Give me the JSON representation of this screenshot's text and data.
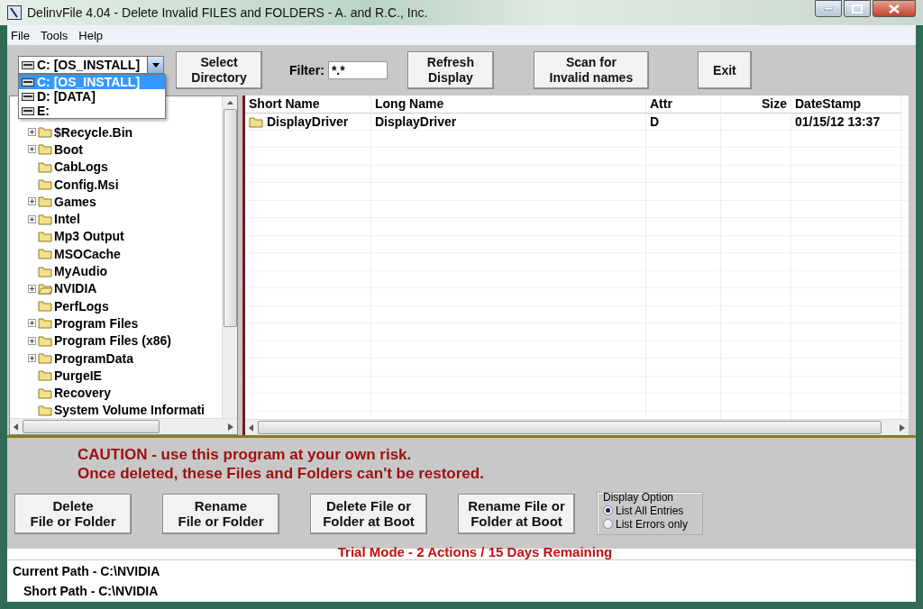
{
  "window": {
    "title": "DelinvFile 4.04 - Delete Invalid FILES and FOLDERS - A. and R.C., Inc."
  },
  "menu": [
    "File",
    "Tools",
    "Help"
  ],
  "drive_combo": {
    "value": "C: [OS_INSTALL]",
    "options": [
      {
        "label": "C: [OS_INSTALL]",
        "selected": true
      },
      {
        "label": "D: [DATA]",
        "selected": false
      },
      {
        "label": "E:",
        "selected": false
      }
    ]
  },
  "toolbar": [
    {
      "kind": "button",
      "lines": [
        "Select",
        "Directory"
      ]
    },
    {
      "kind": "filter",
      "label": "Filter:",
      "value": "*.*"
    },
    {
      "kind": "button",
      "lines": [
        "Refresh",
        "Display"
      ]
    },
    {
      "kind": "button",
      "lines": [
        "Scan for",
        "Invalid names"
      ]
    },
    {
      "kind": "button",
      "lines": [
        "Exit"
      ]
    }
  ],
  "tree": {
    "items": [
      {
        "label": "$Recycle.Bin",
        "expandable": true
      },
      {
        "label": "Boot",
        "expandable": true
      },
      {
        "label": "CabLogs",
        "expandable": false
      },
      {
        "label": "Config.Msi",
        "expandable": false
      },
      {
        "label": "Games",
        "expandable": true
      },
      {
        "label": "Intel",
        "expandable": true
      },
      {
        "label": "Mp3 Output",
        "expandable": false
      },
      {
        "label": "MSOCache",
        "expandable": false
      },
      {
        "label": "MyAudio",
        "expandable": false
      },
      {
        "label": "NVIDIA",
        "expandable": true
      },
      {
        "label": "PerfLogs",
        "expandable": false
      },
      {
        "label": "Program Files",
        "expandable": true
      },
      {
        "label": "Program Files (x86)",
        "expandable": true
      },
      {
        "label": "ProgramData",
        "expandable": true
      },
      {
        "label": "PurgeIE",
        "expandable": false
      },
      {
        "label": "Recovery",
        "expandable": false
      },
      {
        "label": "System Volume Informati",
        "expandable": false
      }
    ]
  },
  "file_list": {
    "columns": [
      "Short Name",
      "Long Name",
      "Attr",
      "Size",
      "DateStamp"
    ],
    "rows": [
      {
        "short_name": "DisplayDriver",
        "long_name": "DisplayDriver",
        "attr": "D",
        "datestamp": "01/15/12 13:37"
      }
    ]
  },
  "caution": [
    "CAUTION - use this program at your own risk.",
    "Once deleted, these Files and Folders can't be restored."
  ],
  "actions": [
    {
      "lines": [
        "Delete",
        "File or Folder"
      ]
    },
    {
      "lines": [
        "Rename",
        "File or Folder"
      ]
    },
    {
      "lines": [
        "Delete File or",
        "Folder at Boot"
      ]
    },
    {
      "lines": [
        "Rename File or",
        "Folder at Boot"
      ]
    }
  ],
  "display_option": {
    "title": "Display Option",
    "options": [
      {
        "label": "List All Entries",
        "selected": true
      },
      {
        "label": "List Errors only",
        "selected": false
      }
    ]
  },
  "trial": "Trial Mode - 2 Actions / 15 Days Remaining",
  "status": [
    "Current Path - C:\\NVIDIA",
    "Short Path - C:\\NVIDIA"
  ]
}
